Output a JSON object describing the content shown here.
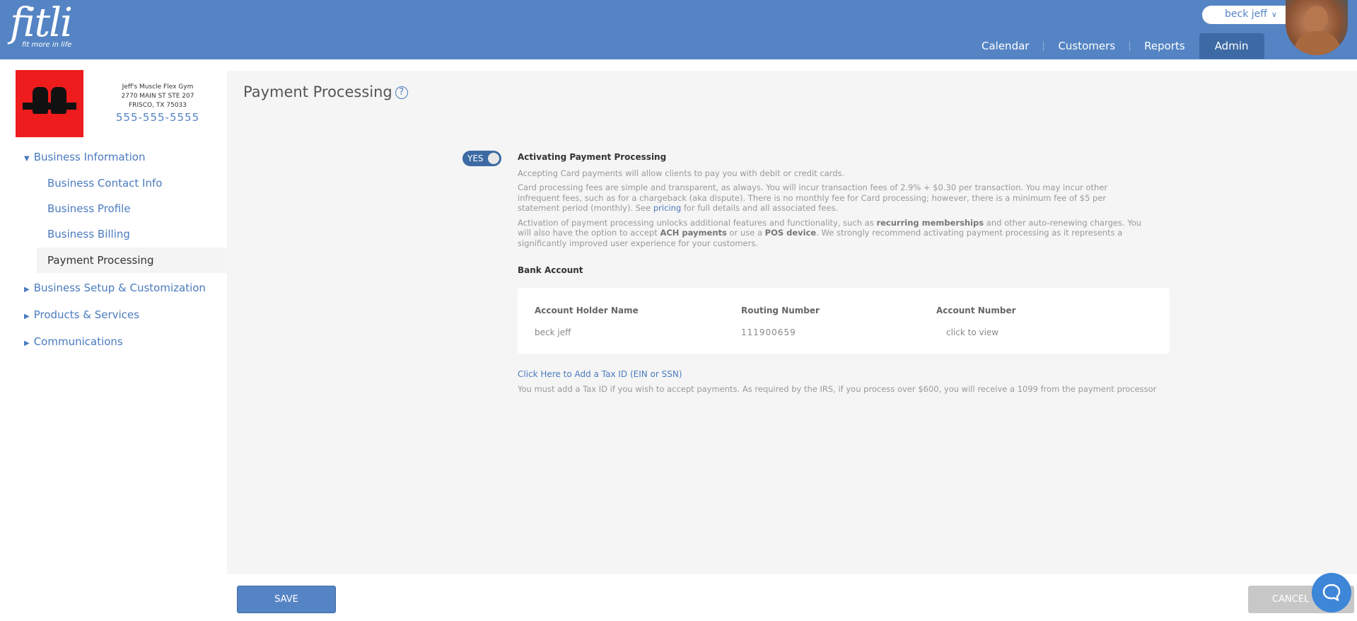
{
  "header": {
    "logo_text": "fitli",
    "logo_tagline": "fit more in life",
    "user_name": "beck jeff",
    "nav": [
      "Calendar",
      "Customers",
      "Reports",
      "Admin"
    ]
  },
  "business": {
    "name": "Jeff's Muscle Flex Gym",
    "address_line1": "2770 MAIN ST STE 207",
    "address_line2": "FRISCO, TX 75033",
    "phone": "555-555-5555"
  },
  "sidebar": {
    "sections": [
      "Business Information",
      "Business Setup & Customization",
      "Products & Services",
      "Communications"
    ],
    "sub_items": [
      "Business Contact Info",
      "Business Profile",
      "Business Billing",
      "Payment Processing"
    ]
  },
  "main": {
    "page_title": "Payment Processing",
    "toggle_label": "YES",
    "section_title": "Activating Payment Processing",
    "para1": "Accepting Card payments will allow clients to pay you with debit or credit cards.",
    "para2_text": "Card processing fees are simple and transparent, as always. You will incur transaction fees of 2.9% + $0.30 per transaction. You may incur other infrequent fees, such as for a chargeback (aka dispute). There is no monthly fee for Card processing; however, there is a minimum fee of $5 per statement period (monthly). See ",
    "para2_link": "pricing",
    "para2_tail": " for full details and all associated fees.",
    "para3_a": "Activation of payment processing unlocks additional features and functionality, such as ",
    "para3_b1": "recurring memberships",
    "para3_c": " and other auto-renewing charges. You will also have the option to accept ",
    "para3_b2": "ACH payments",
    "para3_d": " or use a ",
    "para3_b3": "POS device",
    "para3_e": ". We strongly recommend activating payment processing as it represents a significantly improved user experience for your customers.",
    "bank_title": "Bank Account",
    "bank_headers": [
      "Account Holder Name",
      "Routing Number",
      "Account Number"
    ],
    "bank_values": {
      "holder": "beck jeff",
      "routing": "111900659",
      "account_link": "click to view"
    },
    "tax_link": "Click Here to Add a Tax ID (EIN or SSN)",
    "tax_note": "You must add a Tax ID if you wish to accept payments. As required by the IRS, if you process over $600, you will receive a 1099 from the payment processor"
  },
  "footer": {
    "save_label": "SAVE",
    "cancel_label": "CANCEL"
  },
  "colors": {
    "header_bg": "#5584c4",
    "nav_active": "#3d6aa4",
    "link": "#4a7bbf",
    "chat": "#3e86d8",
    "business_logo_bg": "#ee1c1c"
  }
}
